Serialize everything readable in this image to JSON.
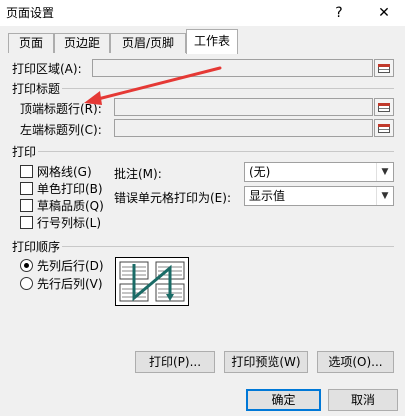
{
  "window": {
    "title": "页面设置",
    "controls": {
      "help": "?",
      "close": "✕"
    }
  },
  "tabs": [
    {
      "label": "页面"
    },
    {
      "label": "页边距"
    },
    {
      "label": "页眉/页脚"
    },
    {
      "label": "工作表",
      "active": true
    }
  ],
  "print_area": {
    "label": "打印区域(A):",
    "value": ""
  },
  "print_titles": {
    "section_label": "打印标题",
    "rows_label": "顶端标题行(R):",
    "rows_value": "",
    "cols_label": "左端标题列(C):",
    "cols_value": ""
  },
  "print": {
    "section_label": "打印",
    "gridlines": {
      "label": "网格线(G)",
      "checked": false
    },
    "black_white": {
      "label": "单色打印(B)",
      "checked": false
    },
    "draft": {
      "label": "草稿品质(Q)",
      "checked": false
    },
    "row_col_headers": {
      "label": "行号列标(L)",
      "checked": false
    },
    "comments_label": "批注(M):",
    "comments_value": "(无)",
    "errors_label": "错误单元格打印为(E):",
    "errors_value": "显示值"
  },
  "page_order": {
    "section_label": "打印顺序",
    "down_then_over": {
      "label": "先列后行(D)",
      "selected": true
    },
    "over_then_down": {
      "label": "先行后列(V)",
      "selected": false
    }
  },
  "panel_buttons": {
    "print": "打印(P)...",
    "preview": "打印预览(W)",
    "options": "选项(O)..."
  },
  "dialog_buttons": {
    "ok": "确定",
    "cancel": "取消"
  },
  "colors": {
    "annotation_arrow": "#e53935",
    "accent": "#0078d7",
    "order_arrow": "#1a6b66"
  }
}
